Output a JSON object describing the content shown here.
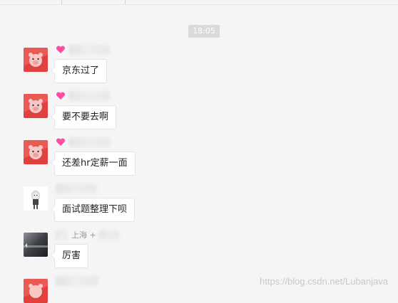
{
  "chat": {
    "timestamp": "18:05",
    "messages": [
      {
        "text": "京东过了"
      },
      {
        "text": "要不要去啊"
      },
      {
        "text": "还差hr定薪一面"
      },
      {
        "text": "面试题整理下呗"
      },
      {
        "sender_location": "上海 +",
        "text": "厉害"
      }
    ]
  },
  "watermark": "https://blog.csdn.net/Lubanjava",
  "colors": {
    "chat_background": "#f5f5f5",
    "bubble_background": "#ffffff",
    "heart": "#ff4fa3",
    "avatar_red": "#e0413e"
  },
  "icons": [
    "heart-icon",
    "pig-avatar",
    "anime-avatar",
    "dark-avatar"
  ]
}
